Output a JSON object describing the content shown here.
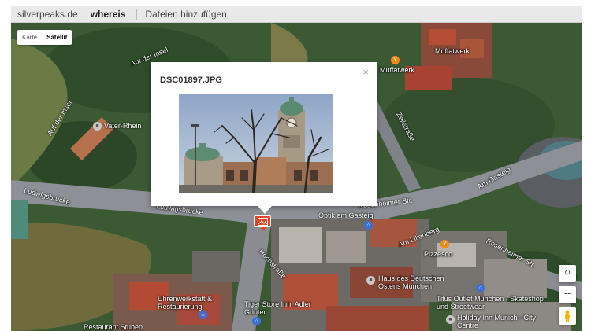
{
  "topbar": {
    "brand": "silverpeaks.de",
    "active_nav": "whereis",
    "link": "Dateien hinzufügen"
  },
  "map": {
    "map_type": {
      "map_label": "Karte",
      "satellite_label": "Satellit",
      "selected": "Satellit"
    },
    "labels": {
      "auf_der_insel_top": "Auf der Insel",
      "auf_der_insel_left": "Auf der Insel",
      "vater_rhein": "Vater-Rhein",
      "muffatwerk_top": "Muffatwerk",
      "muffatwerk_poi": "Muffatwerk",
      "zellstrasse": "Zellstraße",
      "ludwigsbruecke_left": "Ludwigsbrücke",
      "ludwigsbruecke_mid": "Ludwigsbrücke",
      "rosenheimer_str_top": "Rosenheimer Str.",
      "am_gasteig": "Am Gasteig",
      "optik_am_gasteig": "Optik am Gasteig",
      "am_lilienberg": "Am Lilienberg",
      "pizzesco": "Pizzesco",
      "rosenheimer_str_right": "Rosenheimer Str.",
      "hochstrasse": "Hochstraße",
      "haus_des_deutschen_ostens": "Haus des Deutschen Ostens München",
      "titus_outlet": "Titus Outlet München - Skateshop und Streetwear",
      "uhrenwerkstatt": "Uhrenwerkstatt & Restaurierung",
      "tiger_store": "Tiger Store Inh. Adler Günter",
      "holiday_inn": "Holiday Inn Munich - City Centre",
      "restaurant": "Restaurant Stuben"
    },
    "controls": {
      "rotate": "↻",
      "tilt": "⚏",
      "pegman": "person-icon"
    }
  },
  "infowindow": {
    "title": "DSC01897.JPG",
    "close": "×"
  }
}
